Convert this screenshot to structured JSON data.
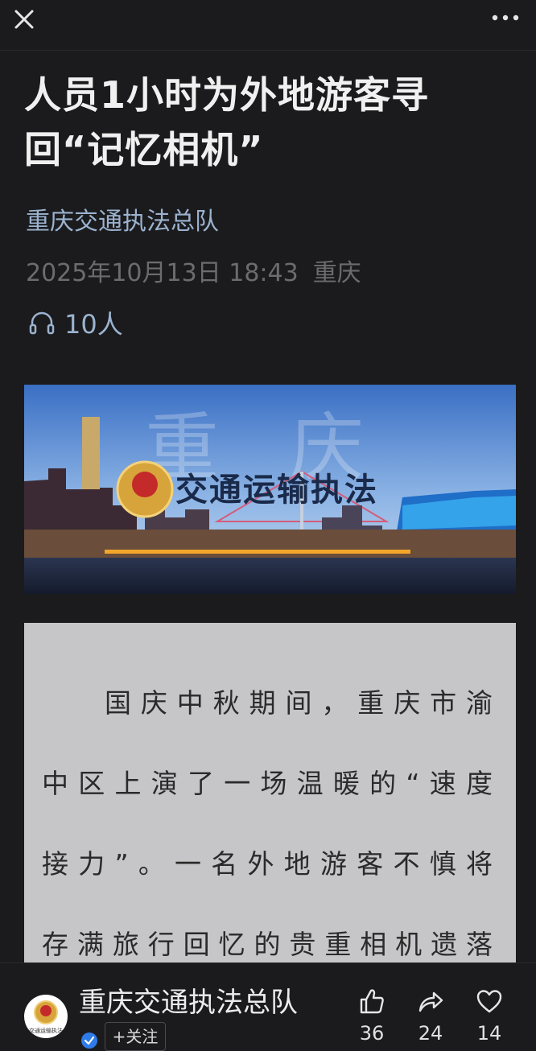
{
  "topbar": {
    "close_icon": "close-icon",
    "more_icon": "more-dots-icon"
  },
  "article": {
    "title": "人员1小时为外地游客寻回“记忆相机”",
    "source": "重庆交通执法总队",
    "date": "2025年10月13日 18:43",
    "location": "重庆",
    "listen_count": "10人"
  },
  "banner": {
    "text": "交通运输执法"
  },
  "quote": {
    "text": "国庆中秋期间，重庆市渝中区上演了一场温暖的“速度接力”。一名外地游客不慎将存满旅行回忆的贵重相机遗落在出租车"
  },
  "bottom": {
    "account_name": "重庆交通执法总队",
    "avatar_caption": "交通运输执法",
    "follow_label": "+关注",
    "likes": "36",
    "shares": "24",
    "favorites": "14"
  },
  "colors": {
    "background": "#1b1b1d",
    "link": "#9bb3cf",
    "quote_bg": "#c6c6c9"
  }
}
